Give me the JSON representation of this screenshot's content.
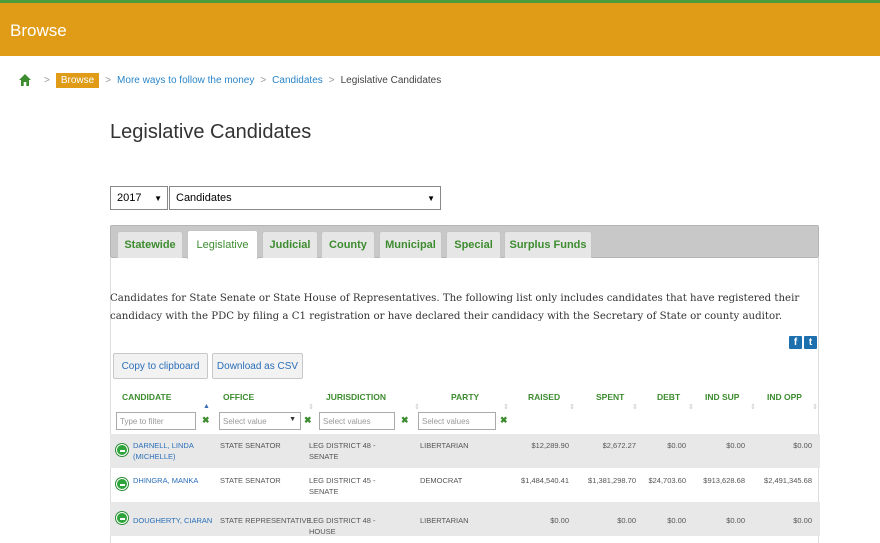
{
  "header": {
    "title": "Browse"
  },
  "breadcrumb": {
    "chip": "Browse",
    "link1": "More ways to follow the money",
    "link2": "Candidates",
    "current": "Legislative Candidates",
    "separator": ">"
  },
  "page": {
    "title": "Legislative Candidates"
  },
  "selects": {
    "year": "2017",
    "type": "Candidates"
  },
  "tabs": [
    "Statewide",
    "Legislative",
    "Judicial",
    "County",
    "Municipal",
    "Special",
    "Surplus Funds"
  ],
  "active_tab": "Legislative",
  "description": "Candidates for State Senate or State House of Representatives. The following list only includes candidates that have registered their candidacy with the PDC by filing a C1 registration or have declared their candidacy with the Secretary of State or county auditor.",
  "buttons": {
    "copy": "Copy to clipboard",
    "download": "Download as CSV"
  },
  "social": {
    "facebook": "f",
    "twitter": "t"
  },
  "table": {
    "headers": [
      "CANDIDATE",
      "OFFICE",
      "JURISDICTION",
      "PARTY",
      "RAISED",
      "SPENT",
      "DEBT",
      "IND SUP",
      "IND OPP"
    ],
    "filters": {
      "candidate": "Type to filter",
      "office": "Select value",
      "jurisdiction": "Select values",
      "party": "Select values",
      "clear": "✖"
    },
    "rows": [
      {
        "name1": "DARNELL, LINDA",
        "name2": "(MICHELLE)",
        "office": "STATE SENATOR",
        "jur1": "LEG DISTRICT 48 -",
        "jur2": "SENATE",
        "party": "LIBERTARIAN",
        "raised": "$12,289.90",
        "spent": "$2,672.27",
        "debt": "$0.00",
        "indsup": "$0.00",
        "indopp": "$0.00"
      },
      {
        "name1": "DHINGRA, MANKA",
        "name2": "",
        "office": "STATE SENATOR",
        "jur1": "LEG DISTRICT 45 -",
        "jur2": "SENATE",
        "party": "DEMOCRAT",
        "raised": "$1,484,540.41",
        "spent": "$1,381,298.70",
        "debt": "$24,703.60",
        "indsup": "$913,628.68",
        "indopp": "$2,491,345.68"
      },
      {
        "name1": "DOUGHERTY, CIARAN",
        "name2": "",
        "office": "STATE REPRESENTATIVE",
        "jur1": "LEG DISTRICT 48 -",
        "jur2": "HOUSE",
        "party": "LIBERTARIAN",
        "raised": "$0.00",
        "spent": "$0.00",
        "debt": "$0.00",
        "indsup": "$0.00",
        "indopp": "$0.00"
      }
    ]
  },
  "colors": {
    "header": "#e09c17",
    "accent_green": "#3d8c2f",
    "link_blue": "#2a6eb8"
  }
}
